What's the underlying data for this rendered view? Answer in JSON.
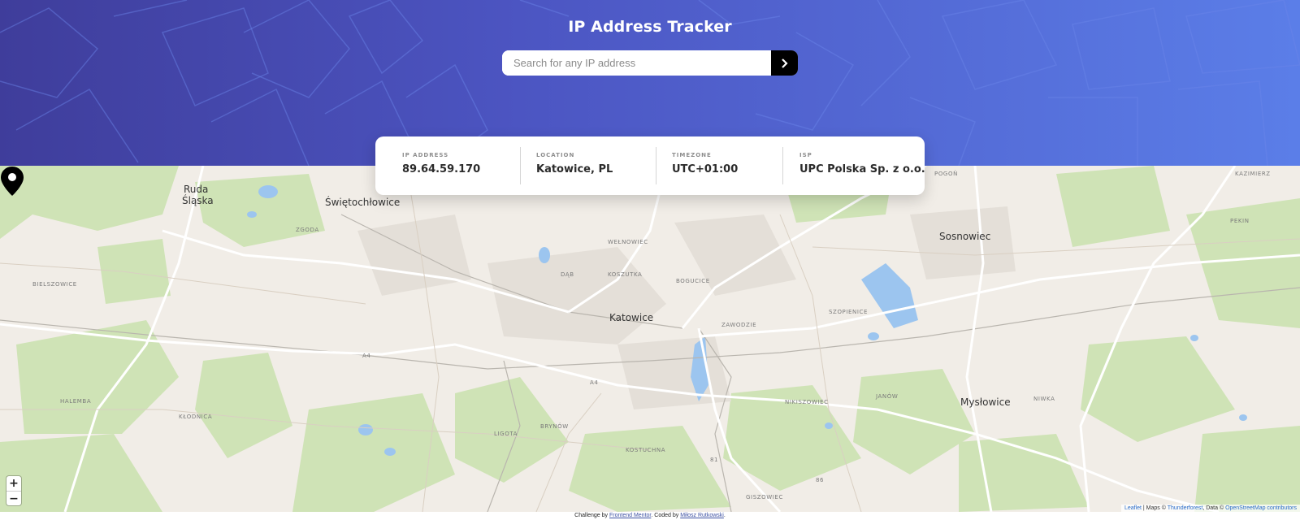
{
  "header": {
    "title": "IP Address Tracker",
    "search_placeholder": "Search for any IP address"
  },
  "info": {
    "ip_label": "IP ADDRESS",
    "ip_value": "89.64.59.170",
    "location_label": "LOCATION",
    "location_value": "Katowice, PL",
    "timezone_label": "TIMEZONE",
    "timezone_value": "UTC+01:00",
    "isp_label": "ISP",
    "isp_value": "UPC Polska Sp. z o.o."
  },
  "map": {
    "zoom_in": "+",
    "zoom_out": "−",
    "places": {
      "ruda": "Ruda",
      "slaska": "Śląska",
      "swietochlowice": "Świętochłowice",
      "katowice": "Katowice",
      "sosnowiec": "Sosnowiec",
      "myslowice": "Mysłowice",
      "dab": "DĄB",
      "koszutka": "KOSZUTKA",
      "zawodzie": "ZAWODZIE",
      "bogucice": "BOGUCICE",
      "welnowiec": "WEŁNOWIEC",
      "ligota": "LIGOTA",
      "brynow": "BRYNÓW",
      "kostuchna": "KOSTUCHNA",
      "nikiszowiec": "NIKISZOWIEC",
      "janow": "JANÓW",
      "szopienice": "SZOPIENICE",
      "halemba": "HALEMBA",
      "klodnica": "KŁODNICA",
      "bielszowice": "BIELSZOWICE",
      "zgoda": "ZGODA",
      "giszowiec": "GISZOWIEC",
      "pogon": "POGOŃ",
      "kazimierz": "KAZIMIERZ",
      "niwka": "NIWKA",
      "pekin": "Pekin",
      "a4": "A4",
      "r81": "81",
      "r86": "86"
    },
    "attribution": {
      "leaflet": "Leaflet",
      "maps_by": "| Maps ©",
      "thunderforest": "Thunderforest",
      "data_by": ", Data ©",
      "osm": "OpenStreetMap contributors"
    }
  },
  "footer": {
    "prefix": "Challenge by",
    "frontend_mentor": "Frontend Mentor",
    "coded_by": ". Coded by",
    "author": "Miłosz Rutkowski",
    "suffix": "."
  },
  "colors": {
    "hero_start": "#3f3d9b",
    "hero_end": "#5b7ee8",
    "button": "#000000",
    "map_base": "#f1ede7",
    "map_green": "#cfe3b6",
    "map_water": "#9cc5ef"
  }
}
